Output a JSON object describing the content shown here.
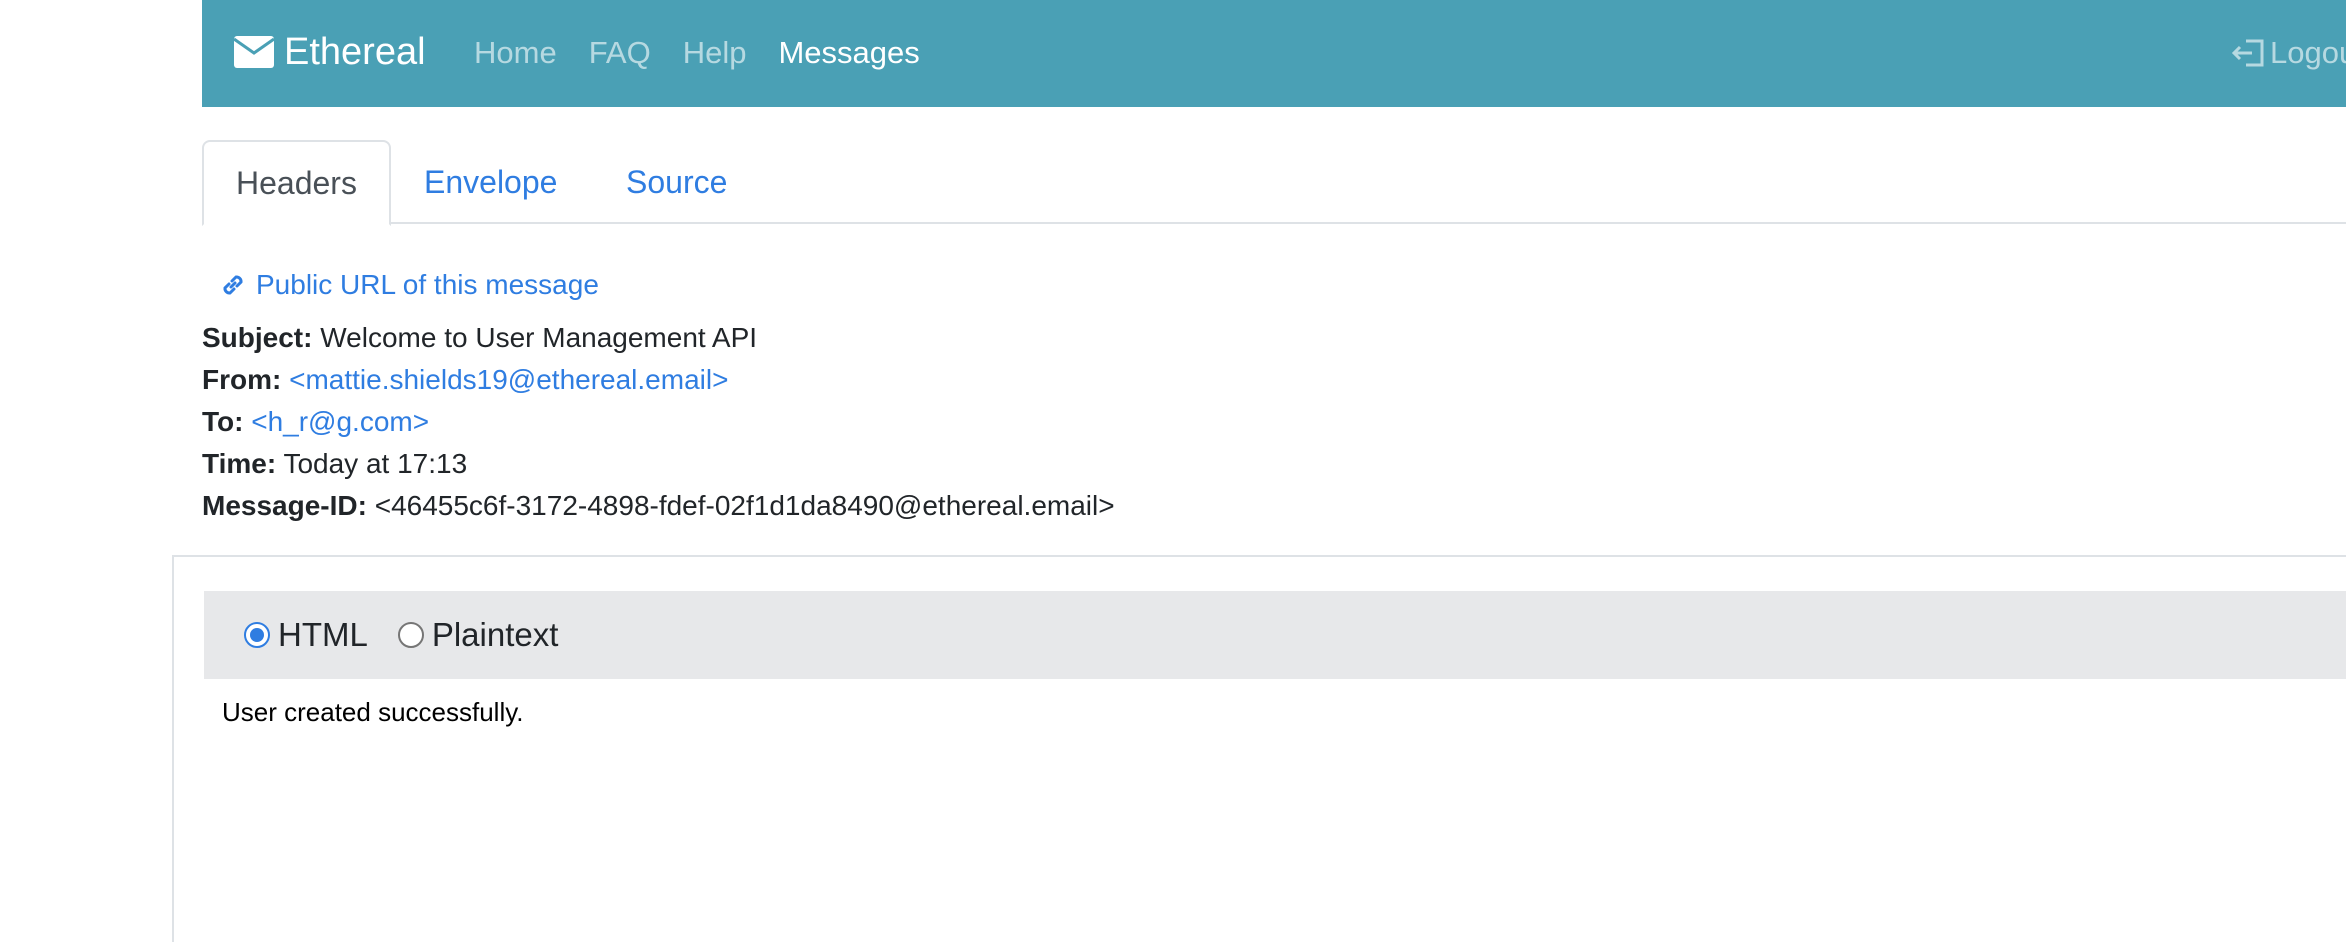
{
  "navbar": {
    "brand": "Ethereal",
    "links": [
      "Home",
      "FAQ",
      "Help",
      "Messages"
    ],
    "active_link": "Messages",
    "logout": "Logout"
  },
  "tabs": [
    "Headers",
    "Envelope",
    "Source"
  ],
  "active_tab": "Headers",
  "public_url": "Public URL of this message",
  "headers": {
    "subject_label": "Subject:",
    "subject": "Welcome to User Management API",
    "from_label": "From:",
    "from": "<mattie.shields19@ethereal.email>",
    "to_label": "To:",
    "to": "<h_r@g.com>",
    "time_label": "Time:",
    "time": "Today at 17:13",
    "message_id_label": "Message-ID:",
    "message_id": "<46455c6f-3172-4898-fdef-02f1d1da8490@ethereal.email>"
  },
  "view": {
    "html_label": "HTML",
    "plaintext_label": "Plaintext",
    "selected": "HTML"
  },
  "message_body": "User created successfully.",
  "colors": {
    "navbar": "#4aa0b5",
    "link": "#2f7de1",
    "toolbar": "#e7e8ea"
  }
}
